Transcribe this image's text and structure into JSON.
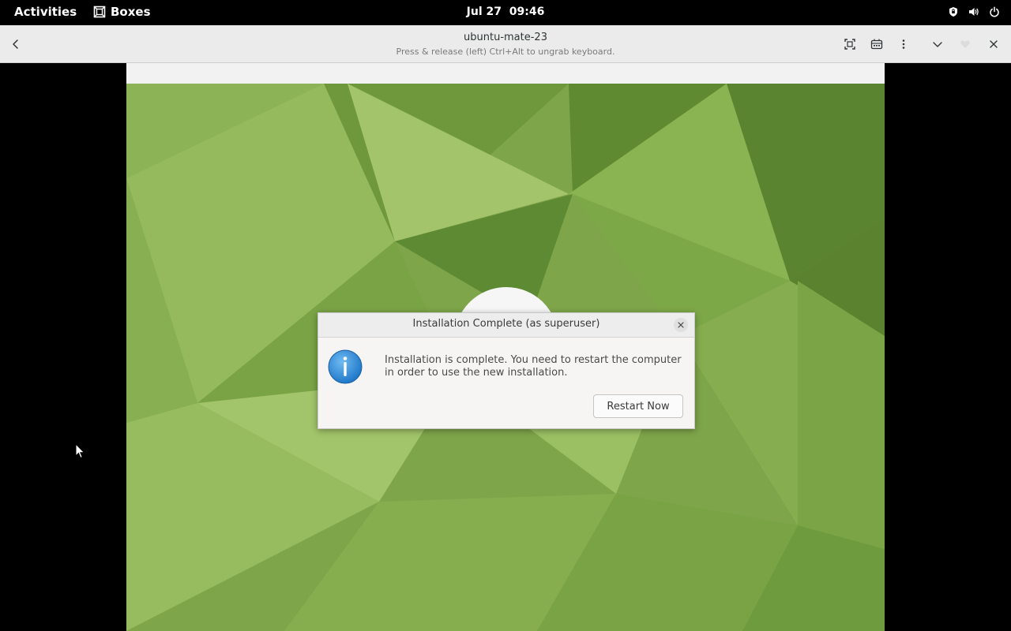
{
  "topbar": {
    "activities_label": "Activities",
    "app_name": "Boxes",
    "clock": "Jul 27  09:46",
    "tray_icons": [
      "vpn-shield-icon",
      "volume-icon",
      "power-icon"
    ]
  },
  "headerbar": {
    "title": "ubuntu-mate-23",
    "subtitle": "Press & release (left) Ctrl+Alt to ungrab keyboard.",
    "buttons": [
      "back-icon",
      "fullscreen-icon",
      "keyboard-shortcuts-icon",
      "menu-icon",
      "chevron-down-icon",
      "favorite-icon",
      "close-icon"
    ]
  },
  "dialog": {
    "title": "Installation Complete (as superuser)",
    "message": "Installation is complete. You need to restart the computer in order to use the new installation.",
    "restart_label": "Restart Now",
    "icon": "info-icon"
  },
  "colors": {
    "topbar_bg": "#000000",
    "headerbar_bg": "#ebebeb",
    "wallpaper_green": "#7ea54a",
    "info_blue": "#2f8fdc"
  }
}
